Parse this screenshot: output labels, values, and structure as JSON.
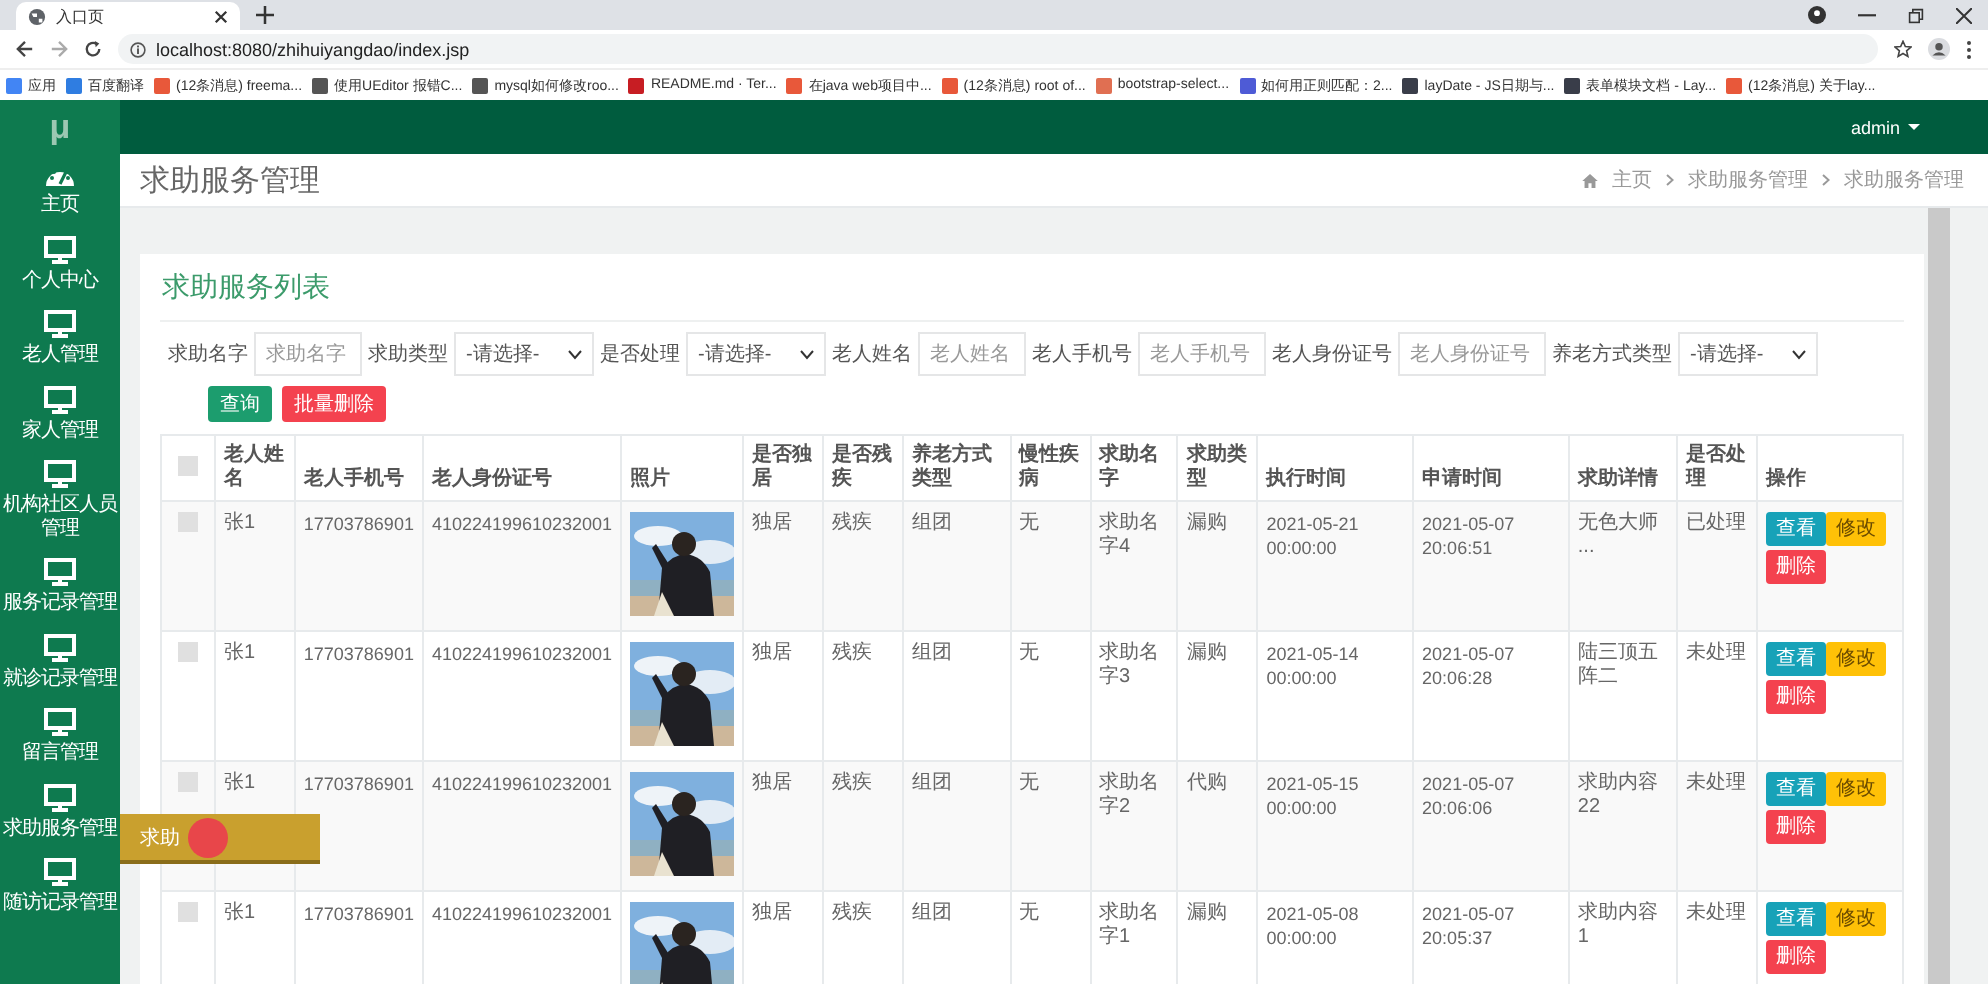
{
  "browser": {
    "tab_title": "入口页",
    "url": "localhost:8080/zhihuiyangdao/index.jsp",
    "bookmarks": [
      {
        "label": "应用",
        "color": "#4285f4"
      },
      {
        "label": "百度翻译",
        "color": "#2f7de1"
      },
      {
        "label": "(12条消息) freema...",
        "color": "#e8583a"
      },
      {
        "label": "使用UEditor 报错C...",
        "color": "#555555"
      },
      {
        "label": "mysql如何修改roo...",
        "color": "#555555"
      },
      {
        "label": "README.md · Ter...",
        "color": "#c71d23"
      },
      {
        "label": "在java web项目中...",
        "color": "#e8583a"
      },
      {
        "label": "(12条消息) root of...",
        "color": "#e8583a"
      },
      {
        "label": "bootstrap-select...",
        "color": "#e06f52"
      },
      {
        "label": "如何用正则匹配：2...",
        "color": "#4e5bd6"
      },
      {
        "label": "layDate - JS日期与...",
        "color": "#393d49"
      },
      {
        "label": "表单模块文档 - Lay...",
        "color": "#393d49"
      },
      {
        "label": "(12条消息) 关于lay...",
        "color": "#e8583a"
      }
    ]
  },
  "app": {
    "logo": "μ",
    "user": "admin",
    "sidebar": {
      "items": [
        {
          "label": "主页",
          "kind": "dashboard"
        },
        {
          "label": "个人中心",
          "kind": "monitor"
        },
        {
          "label": "老人管理",
          "kind": "monitor"
        },
        {
          "label": "家人管理",
          "kind": "monitor"
        },
        {
          "label": "机构社区人员管理",
          "kind": "monitor"
        },
        {
          "label": "服务记录管理",
          "kind": "monitor"
        },
        {
          "label": "就诊记录管理",
          "kind": "monitor"
        },
        {
          "label": "留言管理",
          "kind": "monitor"
        },
        {
          "label": "求助服务管理",
          "kind": "monitor"
        },
        {
          "label": "随访记录管理",
          "kind": "monitor"
        }
      ]
    },
    "tooltip": {
      "text": "求助"
    }
  },
  "page": {
    "title": "求助服务管理",
    "breadcrumb": [
      "主页",
      "求助服务管理",
      "求助服务管理"
    ]
  },
  "card": {
    "title": "求助服务列表",
    "filters": [
      {
        "label": "求助名字",
        "kind": "input",
        "placeholder": "求助名字"
      },
      {
        "label": "求助类型",
        "kind": "select",
        "value": "-请选择-"
      },
      {
        "label": "是否处理",
        "kind": "select",
        "value": "-请选择-"
      },
      {
        "label": "老人姓名",
        "kind": "input",
        "placeholder": "老人姓名"
      },
      {
        "label": "老人手机号",
        "kind": "input",
        "placeholder": "老人手机号"
      },
      {
        "label": "老人身份证号",
        "kind": "input",
        "placeholder": "老人身份证号"
      },
      {
        "label": "养老方式类型",
        "kind": "select",
        "value": "-请选择-"
      }
    ],
    "buttons": [
      {
        "label": "查询",
        "kind": "primary"
      },
      {
        "label": "批量删除",
        "kind": "danger"
      }
    ],
    "table": {
      "header_checked": false,
      "columns": [
        "老人姓名",
        "老人手机号",
        "老人身份证号",
        "照片",
        "是否独居",
        "是否残疾",
        "养老方式类型",
        "慢性疾病",
        "求助名字",
        "求助类型",
        "执行时间",
        "申请时间",
        "求助详情",
        "是否处理",
        "操作"
      ],
      "rows": [
        {
          "checked": false,
          "cells": [
            "张1",
            "17703786901",
            "410224199610232001",
            {
              "kind": "picture"
            },
            "独居",
            "残疾",
            "组团",
            "无",
            "求助名字4",
            "漏购",
            "2021-05-21 00:00:00",
            "2021-05-07 20:06:51",
            "无色大师 ...",
            "已处理"
          ],
          "actions": [
            {
              "label": "查看",
              "kind": "info"
            },
            {
              "label": "修改",
              "kind": "warning"
            },
            {
              "label": "删除",
              "kind": "danger"
            }
          ]
        },
        {
          "checked": false,
          "cells": [
            "张1",
            "17703786901",
            "410224199610232001",
            {
              "kind": "picture"
            },
            "独居",
            "残疾",
            "组团",
            "无",
            "求助名字3",
            "漏购",
            "2021-05-14 00:00:00",
            "2021-05-07 20:06:28",
            "陆三顶五阵二",
            "未处理"
          ],
          "actions": [
            {
              "label": "查看",
              "kind": "info"
            },
            {
              "label": "修改",
              "kind": "warning"
            },
            {
              "label": "删除",
              "kind": "danger"
            }
          ]
        },
        {
          "checked": false,
          "cells": [
            "张1",
            "17703786901",
            "410224199610232001",
            {
              "kind": "picture"
            },
            "独居",
            "残疾",
            "组团",
            "无",
            "求助名字2",
            "代购",
            "2021-05-15 00:00:00",
            "2021-05-07 20:06:06",
            "求助内容22",
            "未处理"
          ],
          "actions": [
            {
              "label": "查看",
              "kind": "info"
            },
            {
              "label": "修改",
              "kind": "warning"
            },
            {
              "label": "删除",
              "kind": "danger"
            }
          ]
        },
        {
          "checked": false,
          "cells": [
            "张1",
            "17703786901",
            "410224199610232001",
            {
              "kind": "picture"
            },
            "独居",
            "残疾",
            "组团",
            "无",
            "求助名字1",
            "漏购",
            "2021-05-08 00:00:00",
            "2021-05-07 20:05:37",
            "求助内容1",
            "未处理"
          ],
          "actions": [
            {
              "label": "查看",
              "kind": "info"
            },
            {
              "label": "修改",
              "kind": "warning"
            },
            {
              "label": "删除",
              "kind": "danger"
            }
          ]
        }
      ]
    }
  }
}
